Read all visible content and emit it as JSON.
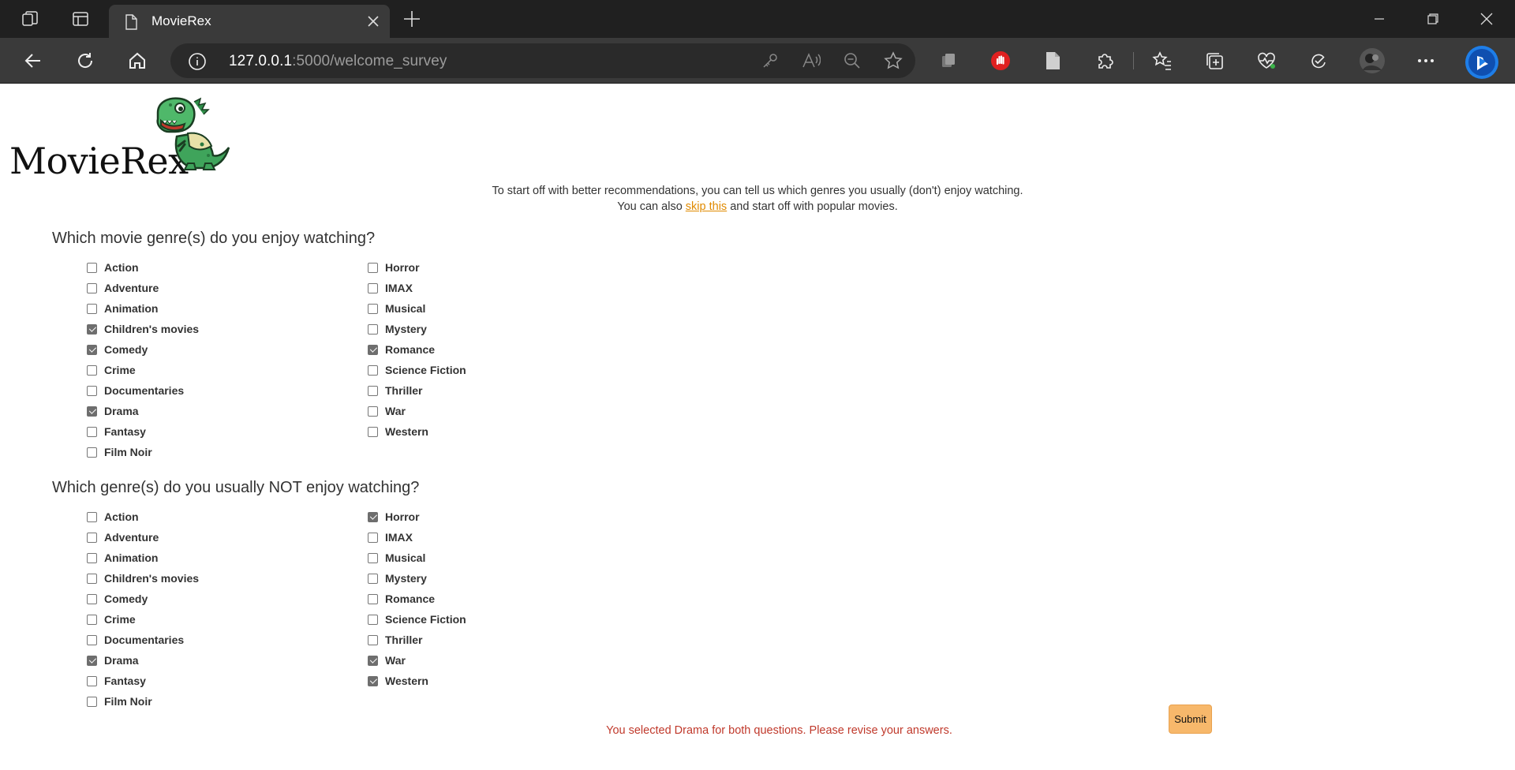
{
  "browser": {
    "tab_title": "MovieRex",
    "url_host": "127.0.0.1",
    "url_rest": ":5000/welcome_survey"
  },
  "page": {
    "logo_text": "MovieRex",
    "intro_line1": "To start off with better recommendations, you can tell us which genres you usually (don't) enjoy watching.",
    "intro_line2_before": "You can also ",
    "intro_link": "skip this",
    "intro_line2_after": " and start off with popular movies.",
    "q1": {
      "heading": "Which movie genre(s) do you enjoy watching?",
      "col1": [
        {
          "label": "Action",
          "checked": false
        },
        {
          "label": "Adventure",
          "checked": false
        },
        {
          "label": "Animation",
          "checked": false
        },
        {
          "label": "Children's movies",
          "checked": true
        },
        {
          "label": "Comedy",
          "checked": true
        },
        {
          "label": "Crime",
          "checked": false
        },
        {
          "label": "Documentaries",
          "checked": false
        },
        {
          "label": "Drama",
          "checked": true
        },
        {
          "label": "Fantasy",
          "checked": false
        },
        {
          "label": "Film Noir",
          "checked": false
        }
      ],
      "col2": [
        {
          "label": "Horror",
          "checked": false
        },
        {
          "label": "IMAX",
          "checked": false
        },
        {
          "label": "Musical",
          "checked": false
        },
        {
          "label": "Mystery",
          "checked": false
        },
        {
          "label": "Romance",
          "checked": true
        },
        {
          "label": "Science Fiction",
          "checked": false
        },
        {
          "label": "Thriller",
          "checked": false
        },
        {
          "label": "War",
          "checked": false
        },
        {
          "label": "Western",
          "checked": false
        }
      ]
    },
    "q2": {
      "heading": "Which genre(s) do you usually NOT enjoy watching?",
      "col1": [
        {
          "label": "Action",
          "checked": false
        },
        {
          "label": "Adventure",
          "checked": false
        },
        {
          "label": "Animation",
          "checked": false
        },
        {
          "label": "Children's movies",
          "checked": false
        },
        {
          "label": "Comedy",
          "checked": false
        },
        {
          "label": "Crime",
          "checked": false
        },
        {
          "label": "Documentaries",
          "checked": false
        },
        {
          "label": "Drama",
          "checked": true
        },
        {
          "label": "Fantasy",
          "checked": false
        },
        {
          "label": "Film Noir",
          "checked": false
        }
      ],
      "col2": [
        {
          "label": "Horror",
          "checked": true
        },
        {
          "label": "IMAX",
          "checked": false
        },
        {
          "label": "Musical",
          "checked": false
        },
        {
          "label": "Mystery",
          "checked": false
        },
        {
          "label": "Romance",
          "checked": false
        },
        {
          "label": "Science Fiction",
          "checked": false
        },
        {
          "label": "Thriller",
          "checked": false
        },
        {
          "label": "War",
          "checked": true
        },
        {
          "label": "Western",
          "checked": true
        }
      ]
    },
    "error": "You selected Drama for both questions. Please revise your answers.",
    "submit_label": "Submit"
  },
  "colors": {
    "accent": "#f7b86b",
    "link": "#e08a00",
    "error": "#c0392b"
  }
}
